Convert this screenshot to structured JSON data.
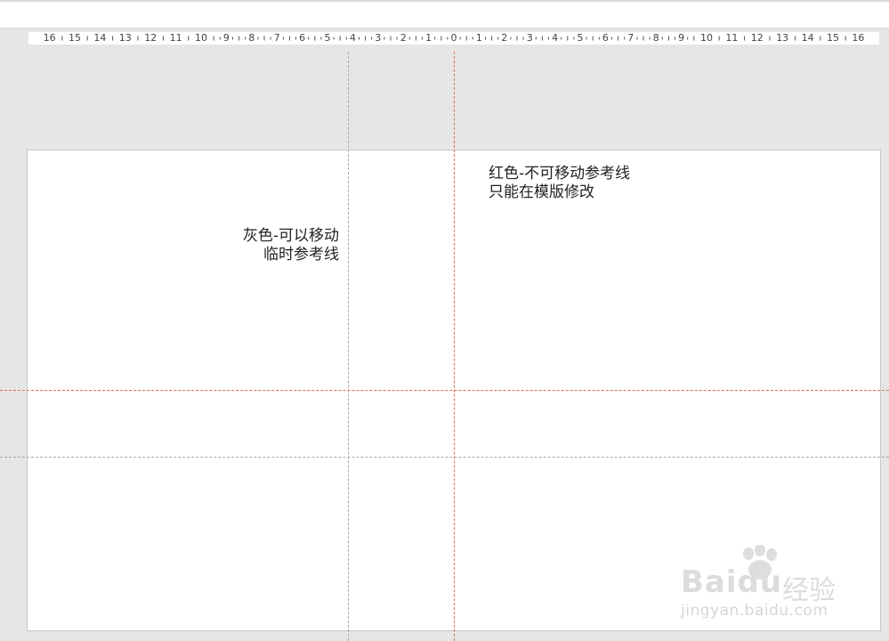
{
  "ruler": {
    "labels": [
      "16",
      "15",
      "14",
      "13",
      "12",
      "11",
      "10",
      "9",
      "8",
      "7",
      "6",
      "5",
      "4",
      "3",
      "2",
      "1",
      "0",
      "1",
      "2",
      "3",
      "4",
      "5",
      "6",
      "7",
      "8",
      "9",
      "10",
      "11",
      "12",
      "13",
      "14",
      "15",
      "16"
    ]
  },
  "annotations": {
    "gray_line1": "灰色-可以移动",
    "gray_line2": "临时参考线",
    "red_line1": "红色-不可移动参考线",
    "red_line2": "只能在模版修改"
  },
  "colors": {
    "gray_guide": "#a9a9a9",
    "red_guide": "#e07040"
  },
  "watermark": {
    "logo": "Baidu",
    "experience": "经验",
    "url": "jingyan.baidu.com"
  }
}
